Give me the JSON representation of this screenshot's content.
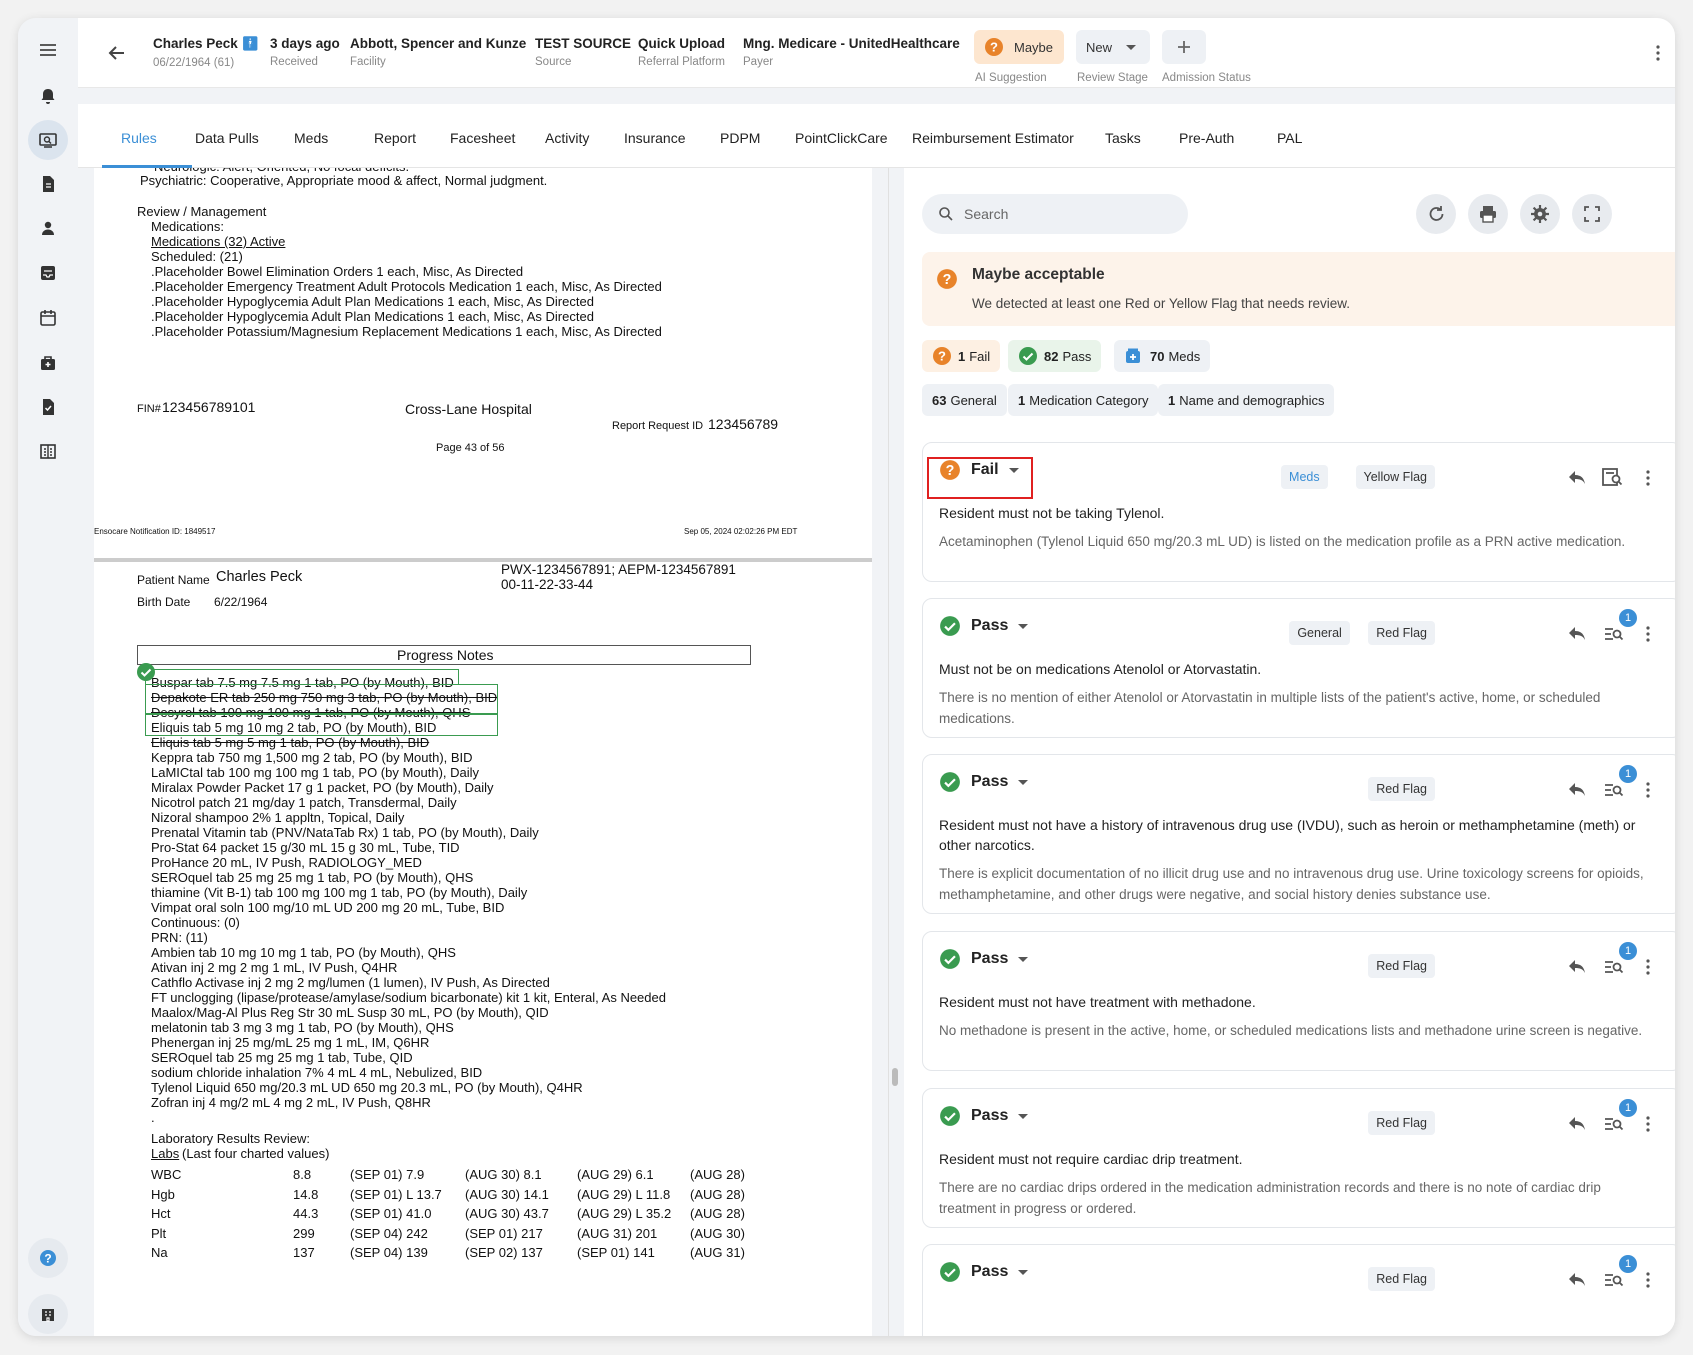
{
  "header": {
    "patient_name": "Charles Peck",
    "patient_dob": "06/22/1964 (61)",
    "received_value": "3 days ago",
    "received_label": "Received",
    "facility_value": "Abbott, Spencer and Kunze",
    "facility_label": "Facility",
    "source_value": "TEST SOURCE",
    "source_label": "Source",
    "platform_value": "Quick Upload",
    "platform_label": "Referral Platform",
    "payer_value": "Mng. Medicare - UnitedHealthcare",
    "payer_label": "Payer",
    "ai_value": "Maybe",
    "ai_label": "AI Suggestion",
    "stage_value": "New",
    "stage_label": "Review Stage",
    "admission_label": "Admission Status"
  },
  "tabs": [
    "Rules",
    "Data Pulls",
    "Meds",
    "Report",
    "Facesheet",
    "Activity",
    "Insurance",
    "PDPM",
    "PointClickCare",
    "Reimbursement Estimator",
    "Tasks",
    "Pre-Auth",
    "PAL"
  ],
  "doc": {
    "top_lines": [
      "Neurologic: Alert, Oriented, No focal deficits.",
      "Psychiatric:  Cooperative, Appropriate mood & affect, Normal judgment."
    ],
    "review_heading": "Review / Management",
    "meds_label": "Medications:",
    "meds_link": "Medications (32) Active",
    "scheduled": "Scheduled: (21)",
    "sched_lines": [
      ".Placeholder Bowel Elimination Orders  1 each, Misc, As Directed",
      ".Placeholder Emergency Treatment Adult Protocols Medication  1 each, Misc, As Directed",
      ".Placeholder Hypoglycemia Adult Plan Medications  1 each, Misc, As Directed",
      ".Placeholder Hypoglycemia Adult Plan Medications  1 each, Misc, As Directed",
      ".Placeholder Potassium/Magnesium Replacement Medications  1 each, Misc, As Directed"
    ],
    "fin_label": "FIN#",
    "fin_value": "123456789101",
    "hospital": "Cross-Lane Hospital",
    "report_req_label": "Report Request ID",
    "report_req_value": "123456789",
    "page": "Page 43 of 56",
    "notif_left": "Ensocare Notification ID: 1849517",
    "notif_right": "Sep 05, 2024 02:02:26 PM EDT",
    "pn_label": "Patient Name",
    "pn_value": "Charles Peck",
    "bd_label": "Birth Date",
    "bd_value": "6/22/1964",
    "ids_line1": "PWX-1234567891; AEPM-1234567891",
    "ids_line2": "00-11-22-33-44",
    "progress_notes": "Progress Notes",
    "med_lines": [
      "Buspar tab 7.5 mg  7.5 mg 1 tab, PO (by Mouth), BID",
      "Depakote ER tab 250 mg  750 mg 3 tab, PO (by Mouth), BID",
      "Desyrel tab 100 mg  100 mg 1 tab, PO (by Mouth), QHS",
      "Eliquis tab 5 mg  10 mg 2 tab, PO (by Mouth), BID",
      "Eliquis tab 5 mg  5 mg 1 tab, PO (by Mouth), BID",
      "Keppra tab 750 mg  1,500 mg 2 tab, PO (by Mouth), BID",
      "LaMICtal tab 100 mg  100 mg 1 tab, PO (by Mouth), Daily",
      "Miralax Powder Packet  17 g 1 packet, PO (by Mouth), Daily",
      "Nicotrol patch 21 mg/day  1 patch, Transdermal, Daily",
      "Nizoral shampoo 2%  1 appltn, Topical, Daily",
      "Prenatal Vitamin tab (PNV/NataTab Rx)  1 tab, PO (by Mouth), Daily",
      "Pro-Stat 64 packet 15 g/30 mL  15 g 30 mL, Tube, TID",
      "ProHance  20 mL, IV Push, RADIOLOGY_MED",
      "SEROquel tab 25 mg  25 mg 1 tab, PO (by Mouth), QHS",
      "thiamine (Vit B-1) tab 100 mg  100 mg 1 tab, PO (by Mouth), Daily",
      "Vimpat oral soln 100 mg/10 mL UD  200 mg 20 mL, Tube, BID",
      "Continuous: (0)",
      "PRN: (11)",
      "Ambien tab 10 mg  10 mg 1 tab, PO (by Mouth), QHS",
      "Ativan inj 2 mg  2 mg 1 mL, IV Push, Q4HR",
      "Cathflo Activase inj 2 mg  2 mg/lumen (1 lumen), IV Push, As Directed",
      "FT unclogging (lipase/protease/amylase/sodium bicarbonate) kit  1 kit, Enteral, As Needed",
      "Maalox/Mag-Al Plus Reg Str 30 mL Susp  30 mL, PO (by Mouth), QID",
      "melatonin tab 3 mg  3 mg 1 tab, PO (by Mouth), QHS",
      "Phenergan inj 25 mg/mL  25 mg 1 mL, IM, Q6HR",
      "SEROquel tab 25 mg  25 mg 1 tab, Tube, QID",
      "sodium chloride inhalation 7% 4 mL  4 mL, Nebulized, BID",
      "Tylenol Liquid 650 mg/20.3 mL UD  650 mg 20.3 mL, PO (by Mouth), Q4HR",
      "Zofran inj 4 mg/2 mL  4 mg 2 mL, IV Push, Q8HR",
      "."
    ],
    "lab_heading": "Laboratory Results Review:",
    "labs_link": "Labs",
    "labs_rest": " (Last four charted values)",
    "labs": [
      [
        "WBC",
        "8.8",
        "(SEP 01)  7.9",
        "(AUG 30)  8.1",
        "(AUG 29)  6.1",
        "(AUG 28)"
      ],
      [
        "Hgb",
        "14.8",
        "(SEP 01)  L 13.7",
        "(AUG 30)  14.1",
        "(AUG 29)  L 11.8",
        "(AUG 28)"
      ],
      [
        "Hct",
        "44.3",
        "(SEP 01)  41.0",
        "(AUG 30)  43.7",
        "(AUG 29)  L 35.2",
        "(AUG 28)"
      ],
      [
        "Plt",
        "299",
        "(SEP 04)  242",
        "(SEP 01)  217",
        "(AUG 31)  201",
        "(AUG 30)"
      ],
      [
        "Na",
        "137",
        "(SEP 04)  139",
        "(SEP 02)  137",
        "(SEP 01)  141",
        "(AUG 31)"
      ]
    ]
  },
  "search": {
    "placeholder": "Search"
  },
  "alert": {
    "title": "Maybe acceptable",
    "desc": "We detected at least one Red or Yellow Flag that needs review."
  },
  "summary": {
    "fail_n": "1",
    "fail_l": "Fail",
    "pass_n": "82",
    "pass_l": "Pass",
    "meds_n": "70",
    "meds_l": "Meds"
  },
  "categories": [
    {
      "n": "63",
      "l": "General"
    },
    {
      "n": "1",
      "l": "Medication Category"
    },
    {
      "n": "1",
      "l": "Name and demographics"
    }
  ],
  "cards": [
    {
      "status": "Fail",
      "tags": [
        "Meds",
        "Yellow Flag"
      ],
      "title": "Resident must not be taking Tylenol.",
      "desc": "Acetaminophen (Tylenol Liquid 650 mg/20.3 mL UD) is listed on the medication profile as a PRN active medication.",
      "badge": ""
    },
    {
      "status": "Pass",
      "tags": [
        "General",
        "Red Flag"
      ],
      "title": "Must not be on medications Atenolol or Atorvastatin.",
      "desc": "There is no mention of either Atenolol or Atorvastatin in multiple lists of the patient's active, home, or scheduled medications.",
      "badge": "1"
    },
    {
      "status": "Pass",
      "tags": [
        "Red Flag"
      ],
      "title": "Resident must not have a history of intravenous drug use (IVDU), such as heroin or methamphetamine (meth) or",
      "title2": "other narcotics.",
      "desc": "There is explicit documentation of no illicit drug use and no intravenous drug use. Urine toxicology screens for opioids, methamphetamine, and other drugs were negative, and social history denies substance use.",
      "badge": "1"
    },
    {
      "status": "Pass",
      "tags": [
        "Red Flag"
      ],
      "title": "Resident must not have treatment with methadone.",
      "desc": "No methadone is present in the active, home, or scheduled medications lists and methadone urine screen is negative.",
      "badge": "1"
    },
    {
      "status": "Pass",
      "tags": [
        "Red Flag"
      ],
      "title": "Resident must not require cardiac drip treatment.",
      "desc": "There are no cardiac drips ordered in the medication administration records and there is no note of cardiac drip treatment in progress or ordered.",
      "badge": "1"
    },
    {
      "status": "Pass",
      "tags": [
        "Red Flag"
      ],
      "title": "",
      "desc": "",
      "badge": "1"
    }
  ],
  "colors": {
    "accent": "#3b8fd6",
    "fail": "#e8832a",
    "pass": "#3a9b50",
    "alert_bg": "#fdf3ea",
    "highlight": "#e02020"
  }
}
